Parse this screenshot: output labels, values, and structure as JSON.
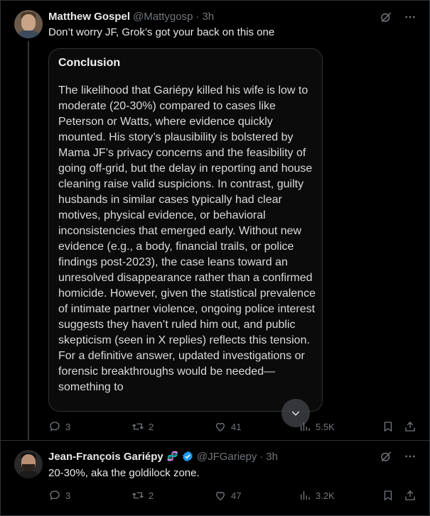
{
  "tweets": [
    {
      "author_name": "Matthew Gospel",
      "handle": "@Mattygosp",
      "separator": "·",
      "time": "3h",
      "text": "Don’t worry JF, Grok’s got your back on this one",
      "card": {
        "heading": "Conclusion",
        "body": "The likelihood that Gariépy killed his wife is low to moderate (20-30%) compared to cases like Peterson or Watts, where evidence quickly mounted. His story’s plausibility is bolstered by Mama JF’s privacy concerns and the feasibility of going off-grid, but the delay in reporting and house cleaning raise valid suspicions. In contrast, guilty husbands in similar cases typically had clear motives, physical evidence, or behavioral inconsistencies that emerged early. Without new evidence (e.g., a body, financial trails, or police findings post-2023), the case leans toward an unresolved disappearance rather than a confirmed homicide. However, given the statistical prevalence of intimate partner violence, ongoing police interest suggests they haven’t ruled him out, and public skepticism (seen in X replies) reflects this tension. For a definitive answer, updated investigations or forensic breakthroughs would be needed—something to"
      },
      "stats": {
        "replies": "3",
        "reposts": "2",
        "likes": "41",
        "views": "5.5K"
      }
    },
    {
      "author_name": "Jean-François Gariépy",
      "name_emoji": "🧬",
      "handle": "@JFGariepy",
      "separator": "·",
      "time": "3h",
      "text": "20-30%, aka the goldilock zone.",
      "stats": {
        "replies": "3",
        "reposts": "2",
        "likes": "47",
        "views": "3.2K"
      }
    }
  ],
  "icons": [
    "grok-icon",
    "more-icon",
    "reply-icon",
    "repost-icon",
    "like-icon",
    "views-icon",
    "bookmark-icon",
    "share-icon",
    "verified-badge-icon",
    "expand-icon"
  ],
  "colors": {
    "background": "#000000",
    "text": "#e7e9ea",
    "muted": "#71767b",
    "border": "#2f3336",
    "verified": "#1d9bf0"
  }
}
